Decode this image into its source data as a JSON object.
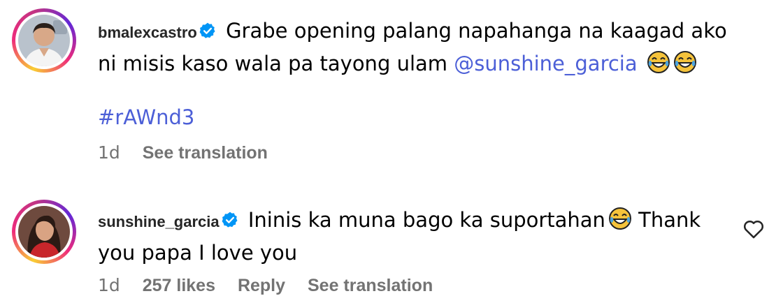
{
  "comments": [
    {
      "username": "bmalexcastro",
      "text": "Grabe opening palang napahanga na kaagad ako ni misis kaso wala pa tayong ulam",
      "mention": "@sunshine_garcia",
      "hashtag": "#rAWnd3",
      "time": "1d",
      "see_translation": "See translation"
    },
    {
      "username": "sunshine_garcia",
      "text_before_emoji": "Ininis ka muna bago ka suportahan",
      "text_after_emoji": "Thank you papa I love you",
      "time": "1d",
      "likes": "257 likes",
      "reply": "Reply",
      "see_translation": "See translation"
    }
  ],
  "colors": {
    "link": "#4c5fd7",
    "verified": "#0095f6",
    "meta": "#737373"
  },
  "icons": [
    "verified-badge-icon",
    "tears-of-joy-emoji",
    "heart-outline-icon"
  ]
}
